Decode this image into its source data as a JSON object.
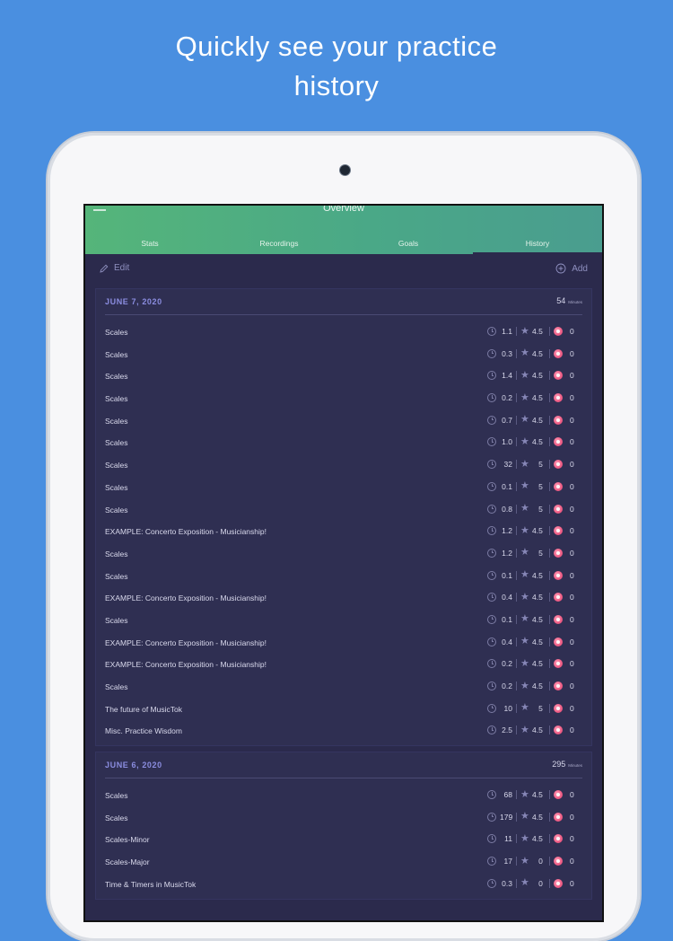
{
  "promo": {
    "line1": "Quickly see your practice",
    "line2": "history"
  },
  "app": {
    "title": "Overview",
    "tabs": [
      "Stats",
      "Recordings",
      "Goals",
      "History"
    ],
    "active_tab": "History",
    "edit_label": "Edit",
    "add_label": "Add"
  },
  "colors": {
    "background": "#4a8fe0",
    "screen": "#2b2a4c",
    "accent": "#8b8de0",
    "header_green": "#4aa887",
    "badge": "#f06088"
  },
  "sessions": [
    {
      "date": "JUNE 7, 2020",
      "total": "54",
      "unit": "Minutes",
      "items": [
        {
          "name": "Scales",
          "time": "1.1",
          "rating": "4.5",
          "count": "0"
        },
        {
          "name": "Scales",
          "time": "0.3",
          "rating": "4.5",
          "count": "0"
        },
        {
          "name": "Scales",
          "time": "1.4",
          "rating": "4.5",
          "count": "0"
        },
        {
          "name": "Scales",
          "time": "0.2",
          "rating": "4.5",
          "count": "0"
        },
        {
          "name": "Scales",
          "time": "0.7",
          "rating": "4.5",
          "count": "0"
        },
        {
          "name": "Scales",
          "time": "1.0",
          "rating": "4.5",
          "count": "0"
        },
        {
          "name": "Scales",
          "time": "32",
          "rating": "5",
          "count": "0"
        },
        {
          "name": "Scales",
          "time": "0.1",
          "rating": "5",
          "count": "0"
        },
        {
          "name": "Scales",
          "time": "0.8",
          "rating": "5",
          "count": "0"
        },
        {
          "name": "EXAMPLE: Concerto Exposition - Musicianship!",
          "time": "1.2",
          "rating": "4.5",
          "count": "0"
        },
        {
          "name": "Scales",
          "time": "1.2",
          "rating": "5",
          "count": "0"
        },
        {
          "name": "Scales",
          "time": "0.1",
          "rating": "4.5",
          "count": "0"
        },
        {
          "name": "EXAMPLE: Concerto Exposition - Musicianship!",
          "time": "0.4",
          "rating": "4.5",
          "count": "0"
        },
        {
          "name": "Scales",
          "time": "0.1",
          "rating": "4.5",
          "count": "0"
        },
        {
          "name": "EXAMPLE: Concerto Exposition - Musicianship!",
          "time": "0.4",
          "rating": "4.5",
          "count": "0"
        },
        {
          "name": "EXAMPLE: Concerto Exposition - Musicianship!",
          "time": "0.2",
          "rating": "4.5",
          "count": "0"
        },
        {
          "name": "Scales",
          "time": "0.2",
          "rating": "4.5",
          "count": "0"
        },
        {
          "name": "The future of MusicTok",
          "time": "10",
          "rating": "5",
          "count": "0"
        },
        {
          "name": "Misc. Practice Wisdom",
          "time": "2.5",
          "rating": "4.5",
          "count": "0"
        }
      ]
    },
    {
      "date": "JUNE 6, 2020",
      "total": "295",
      "unit": "Minutes",
      "items": [
        {
          "name": "Scales",
          "time": "68",
          "rating": "4.5",
          "count": "0"
        },
        {
          "name": "Scales",
          "time": "179",
          "rating": "4.5",
          "count": "0"
        },
        {
          "name": "Scales-Minor",
          "time": "11",
          "rating": "4.5",
          "count": "0"
        },
        {
          "name": "Scales-Major",
          "time": "17",
          "rating": "0",
          "count": "0"
        },
        {
          "name": "Time & Timers in MusicTok",
          "time": "0.3",
          "rating": "0",
          "count": "0"
        }
      ]
    }
  ]
}
